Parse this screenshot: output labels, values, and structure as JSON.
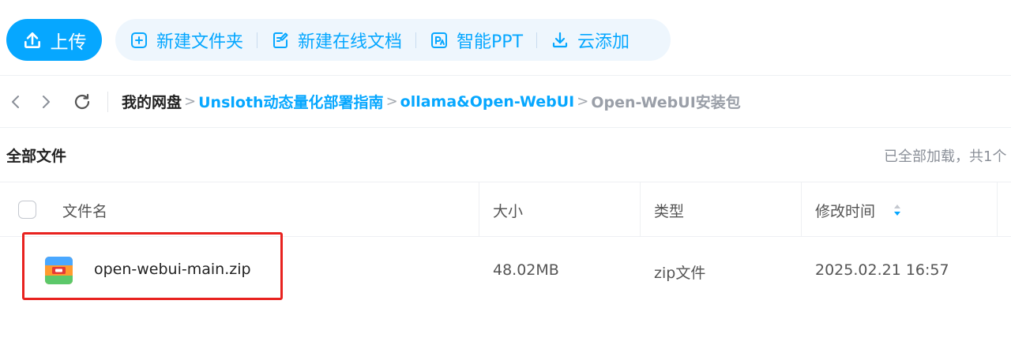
{
  "toolbar": {
    "upload_label": "上传",
    "actions": [
      {
        "label": "新建文件夹",
        "icon": "new-folder-icon"
      },
      {
        "label": "新建在线文档",
        "icon": "new-doc-icon"
      },
      {
        "label": "智能PPT",
        "icon": "smart-ppt-icon"
      },
      {
        "label": "云添加",
        "icon": "cloud-add-icon"
      }
    ]
  },
  "breadcrumb": {
    "root": "我的网盘",
    "items": [
      "Unsloth动态量化部署指南",
      "ollama&Open-WebUI"
    ],
    "current": "Open-WebUI安装包",
    "separator": ">"
  },
  "section": {
    "title": "全部文件",
    "loaded_info": "已全部加载，共1个"
  },
  "table": {
    "columns": [
      "文件名",
      "大小",
      "类型",
      "修改时间"
    ],
    "rows": [
      {
        "name": "open-webui-main.zip",
        "size": "48.02MB",
        "type": "zip文件",
        "modified": "2025.02.21 16:57"
      }
    ]
  },
  "colors": {
    "accent": "#06a7ff",
    "highlight_border": "#e8221f"
  }
}
